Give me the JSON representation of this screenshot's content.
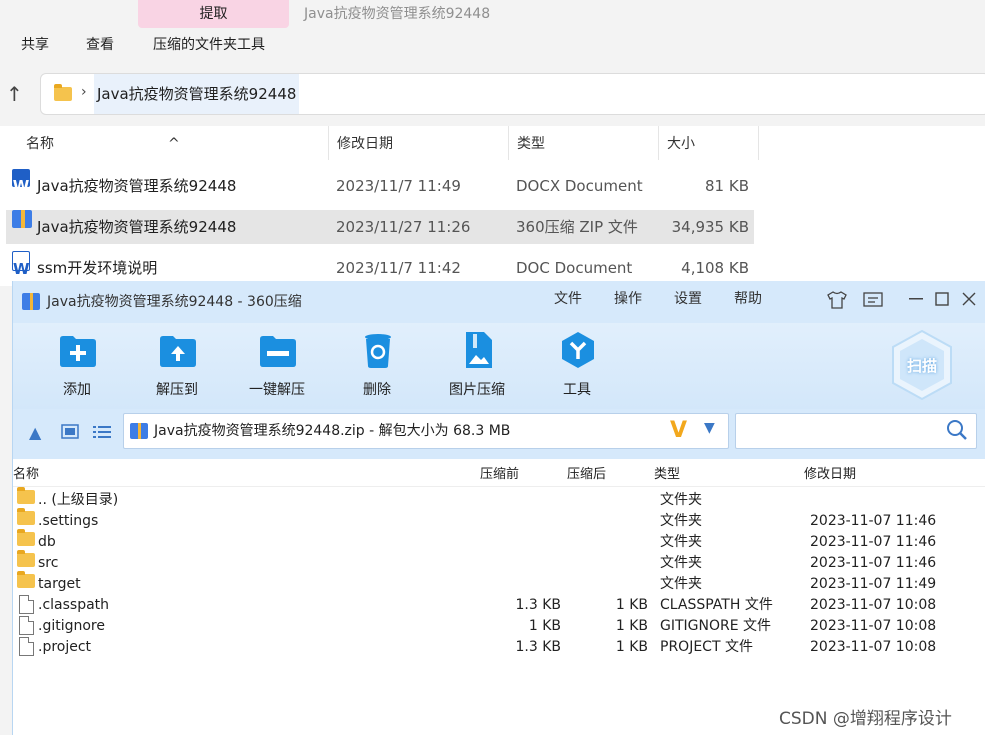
{
  "explorer": {
    "context_tab": "提取",
    "window_title": "Java抗疫物资管理系统92448",
    "menu": [
      "共享",
      "查看",
      "压缩的文件夹工具"
    ],
    "address": "Java抗疫物资管理系统92448",
    "columns": [
      "名称",
      "修改日期",
      "类型",
      "大小"
    ],
    "files": [
      {
        "name": "Java抗疫物资管理系统92448",
        "date": "2023/11/7 11:49",
        "type": "DOCX Document",
        "size": "81 KB",
        "icon": "word-docx-icon"
      },
      {
        "name": "Java抗疫物资管理系统92448",
        "date": "2023/11/27 11:26",
        "type": "360压缩 ZIP 文件",
        "size": "34,935 KB",
        "icon": "zip-archive-icon",
        "selected": true
      },
      {
        "name": "ssm开发环境说明",
        "date": "2023/11/7 11:42",
        "type": "DOC Document",
        "size": "4,108 KB",
        "icon": "word-doc-icon"
      }
    ]
  },
  "zip_window": {
    "title": "Java抗疫物资管理系统92448 - 360压缩",
    "menu": [
      "文件",
      "操作",
      "设置",
      "帮助"
    ],
    "tools": [
      "添加",
      "解压到",
      "一键解压",
      "删除",
      "图片压缩",
      "工具"
    ],
    "scan_label": "扫描",
    "path": "Java抗疫物资管理系统92448.zip - 解包大小为 68.3 MB",
    "search_placeholder": "",
    "columns": [
      "名称",
      "压缩前",
      "压缩后",
      "类型",
      "修改日期"
    ],
    "entries": [
      {
        "name": ".. (上级目录)",
        "before": "",
        "after": "",
        "type": "文件夹",
        "date": "",
        "kind": "folder"
      },
      {
        "name": ".settings",
        "before": "",
        "after": "",
        "type": "文件夹",
        "date": "2023-11-07 11:46",
        "kind": "folder"
      },
      {
        "name": "db",
        "before": "",
        "after": "",
        "type": "文件夹",
        "date": "2023-11-07 11:46",
        "kind": "folder"
      },
      {
        "name": "src",
        "before": "",
        "after": "",
        "type": "文件夹",
        "date": "2023-11-07 11:46",
        "kind": "folder"
      },
      {
        "name": "target",
        "before": "",
        "after": "",
        "type": "文件夹",
        "date": "2023-11-07 11:49",
        "kind": "folder"
      },
      {
        "name": ".classpath",
        "before": "1.3 KB",
        "after": "1 KB",
        "type": "CLASSPATH 文件",
        "date": "2023-11-07 10:08",
        "kind": "file"
      },
      {
        "name": ".gitignore",
        "before": "1 KB",
        "after": "1 KB",
        "type": "GITIGNORE 文件",
        "date": "2023-11-07 10:08",
        "kind": "file"
      },
      {
        "name": ".project",
        "before": "1.3 KB",
        "after": "1 KB",
        "type": "PROJECT 文件",
        "date": "2023-11-07 10:08",
        "kind": "file"
      }
    ]
  },
  "watermark": "CSDN @增翔程序设计",
  "colors": {
    "accent": "#3b78c6",
    "zip_bg": "#d6e9fb",
    "selection": "#e5e5e5",
    "tab_pink": "#f9d4e4"
  }
}
